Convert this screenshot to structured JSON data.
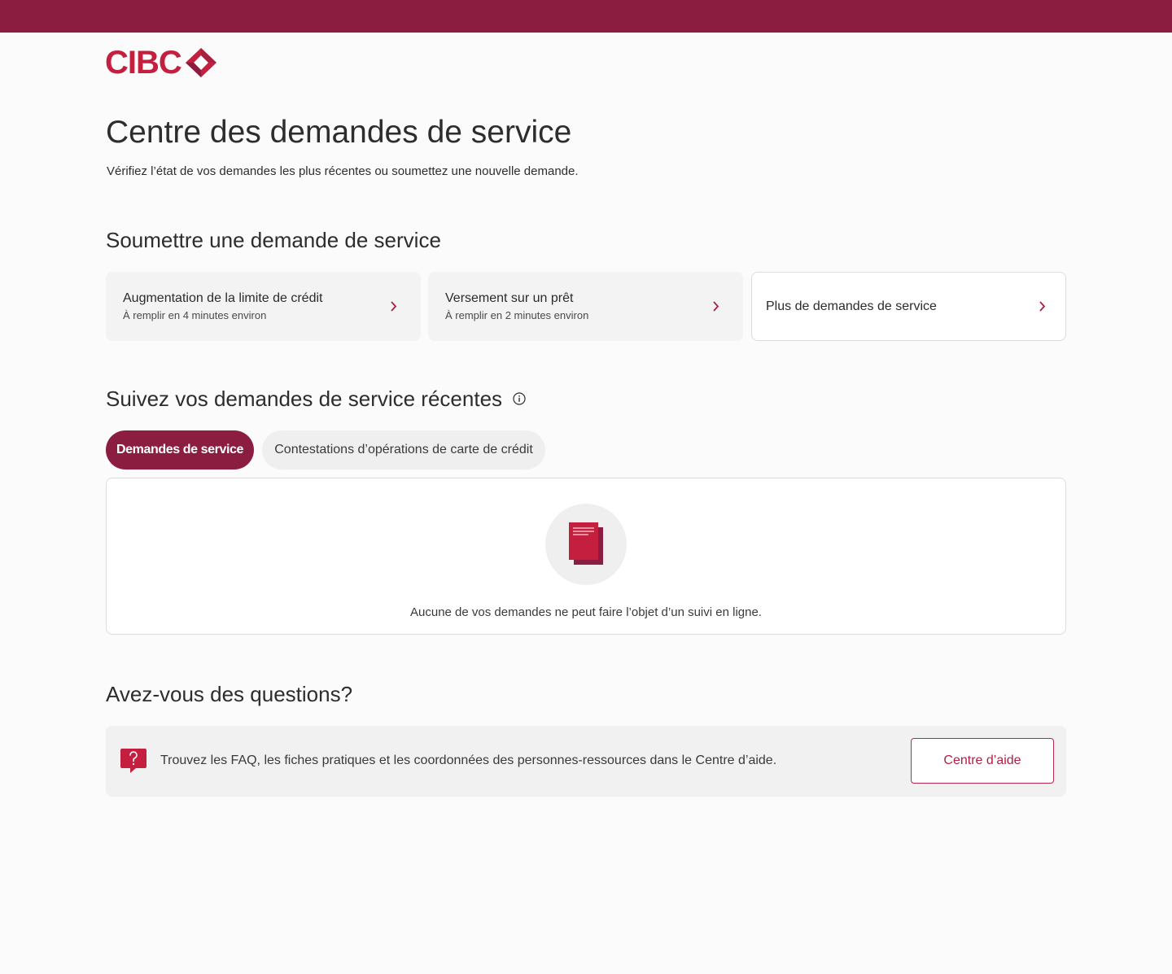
{
  "brand": {
    "name": "CIBC",
    "top_bar_color": "#8b1d41",
    "logo_color": "#c41f3e"
  },
  "header": {
    "title": "Centre des demandes de service",
    "subtitle": "Vérifiez l’état de vos demandes les plus récentes ou soumettez une nouvelle demande."
  },
  "submit_section": {
    "title": "Soumettre une demande de service",
    "cards": [
      {
        "title": "Augmentation de la limite de crédit",
        "subtitle": "À remplir en 4 minutes environ",
        "icon": "chevron-right-icon"
      },
      {
        "title": "Versement sur un prêt",
        "subtitle": "À remplir en 2 minutes environ",
        "icon": "chevron-right-icon"
      },
      {
        "title": "Plus de demandes de service",
        "icon": "chevron-right-icon"
      }
    ]
  },
  "track_section": {
    "title": "Suivez vos demandes de service récentes",
    "info_icon": "info-icon",
    "tabs": [
      {
        "label": "Demandes de service",
        "selected": true
      },
      {
        "label": "Contestations d’opérations de carte de crédit",
        "selected": false
      }
    ],
    "empty_icon": "document-icon",
    "empty_message": "Aucune de vos demandes ne peut faire l’objet d’un suivi en ligne."
  },
  "questions_section": {
    "title": "Avez-vous des questions?",
    "icon": "question-bubble-icon",
    "text": "Trouvez les FAQ, les fiches pratiques et les coordonnées des personnes-ressources dans le Centre d’aide.",
    "button_label": "Centre d’aide"
  },
  "colors": {
    "accent": "#8b1d41",
    "red": "#c41f3e",
    "chevron": "#b01e43"
  }
}
